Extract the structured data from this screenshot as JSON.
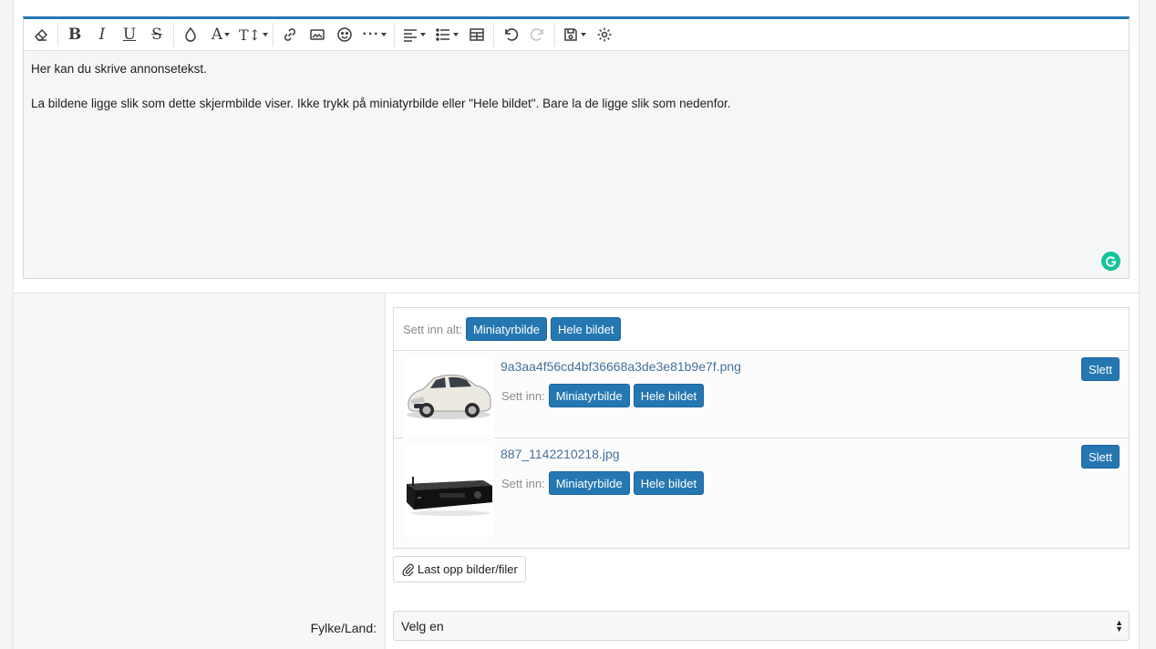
{
  "editor": {
    "toolbar": [
      {
        "name": "remove-format-icon",
        "glyph": "eraser"
      },
      {
        "name": "bold-icon",
        "glyph": "B"
      },
      {
        "name": "italic-icon",
        "glyph": "I"
      },
      {
        "name": "underline-icon",
        "glyph": "U"
      },
      {
        "name": "strikethrough-icon",
        "glyph": "S"
      },
      {
        "name": "text-color-icon",
        "glyph": "drop"
      },
      {
        "name": "font-family-icon",
        "glyph": "A"
      },
      {
        "name": "font-size-icon",
        "glyph": "TT"
      },
      {
        "name": "link-icon",
        "glyph": "link"
      },
      {
        "name": "image-icon",
        "glyph": "image"
      },
      {
        "name": "emoji-icon",
        "glyph": "smile"
      },
      {
        "name": "more-options-icon",
        "glyph": "dots"
      },
      {
        "name": "align-icon",
        "glyph": "align"
      },
      {
        "name": "list-icon",
        "glyph": "list"
      },
      {
        "name": "table-icon",
        "glyph": "table"
      },
      {
        "name": "undo-icon",
        "glyph": "undo"
      },
      {
        "name": "redo-icon",
        "glyph": "redo"
      },
      {
        "name": "save-draft-icon",
        "glyph": "save"
      },
      {
        "name": "settings-icon",
        "glyph": "gear"
      }
    ],
    "paragraphs": [
      "Her kan du skrive annonsetekst.",
      "La bildene ligge slik som dette skjermbilde viser. Ikke trykk på miniatyrbilde eller \"Hele bildet\". Bare la de ligge slik som nedenfor."
    ]
  },
  "attachments": {
    "insert_all_label": "Sett inn alt:",
    "thumbnail_label": "Miniatyrbilde",
    "full_label": "Hele bildet",
    "insert_label": "Sett inn:",
    "delete_label": "Slett",
    "files": [
      {
        "name": "9a3aa4f56cd4bf36668a3de3e81b9e7f.png",
        "thumb": "car"
      },
      {
        "name": "887_1142210218.jpg",
        "thumb": "amplifier"
      }
    ]
  },
  "upload_label": "Last opp bilder/filer",
  "region": {
    "label": "Fylke/Land:",
    "selected": "Velg en"
  },
  "colors": {
    "accent": "#2577b1",
    "link": "#47719c",
    "grammarly": "#15c39a"
  }
}
